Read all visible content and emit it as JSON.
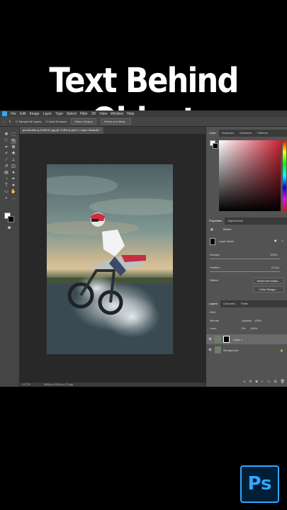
{
  "title": "Text Behind Object",
  "menu": [
    "File",
    "Edit",
    "Image",
    "Layer",
    "Type",
    "Select",
    "Filter",
    "3D",
    "View",
    "Window",
    "Help"
  ],
  "options": {
    "sample_all_layers": "Sample All Layers",
    "auto_enhance": "Auto-Enhance",
    "select_subject": "Select Subject",
    "select_mask": "Select and Mask..."
  },
  "doc_tab": "pexels-fotn-q-1430011.jpg @ 13.8% (Layer 1, Layer Mask/8) *",
  "status": {
    "zoom": "13.77%",
    "info": "3956 px x 5109 px (72 ppi)"
  },
  "color_panel": {
    "tabs": [
      "Color",
      "Swatches",
      "Gradients",
      "Patterns"
    ],
    "accent": "#cc2233"
  },
  "properties": {
    "tabs": [
      "Properties",
      "Adjustments"
    ],
    "masks": "Masks",
    "layer_mask": "Layer Mask",
    "density": "Density:",
    "density_val": "100%",
    "feather": "Feather:",
    "feather_val": "0.0 px",
    "refine": "Refine:",
    "select_mask": "Select and Mask...",
    "color_range": "Color Range..."
  },
  "layers_panel": {
    "tabs": [
      "Layers",
      "Channels",
      "Paths"
    ],
    "kind": "Kind",
    "blend": "Normal",
    "opacity_label": "Opacity:",
    "opacity": "100%",
    "lock": "Lock:",
    "fill_label": "Fill:",
    "fill": "100%",
    "layers": [
      {
        "name": "Layer 1",
        "italic": false
      },
      {
        "name": "Background",
        "italic": true
      }
    ]
  },
  "logo": "Ps"
}
